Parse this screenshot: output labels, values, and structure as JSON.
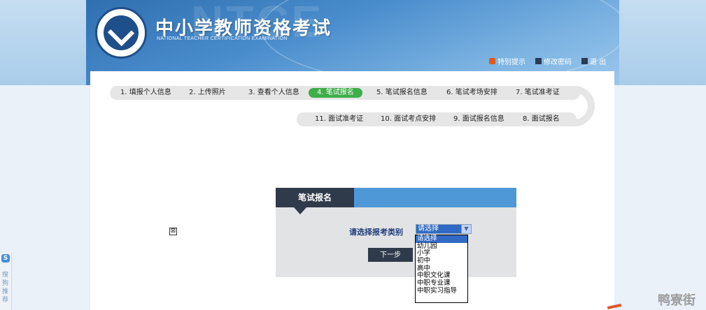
{
  "header": {
    "watermark": "NTCE",
    "title": "中小学教师资格考试",
    "subtitle": "NATIONAL TEACHER CERTIFICATION EXAMINATION",
    "links": [
      {
        "label": "特别提示",
        "icon": "notice-icon",
        "color": "#e05a1a"
      },
      {
        "label": "修改密码",
        "icon": "password-icon",
        "color": "#2b3b55"
      },
      {
        "label": "退 出",
        "icon": "exit-icon",
        "color": "#2b3b55"
      }
    ]
  },
  "steps": {
    "row1": [
      {
        "label": "1. 填报个人信息"
      },
      {
        "label": "2. 上传照片"
      },
      {
        "label": "3. 查看个人信息"
      },
      {
        "label": "4. 笔试报名",
        "active": true
      },
      {
        "label": "5. 笔试报名信息"
      },
      {
        "label": "6. 笔试考场安排"
      },
      {
        "label": "7. 笔试准考证"
      }
    ],
    "row2": [
      {
        "label": "11. 面试准考证"
      },
      {
        "label": "10. 面试考点安排"
      },
      {
        "label": "9. 面试报名信息"
      },
      {
        "label": "8. 面试报名"
      }
    ]
  },
  "form": {
    "tab_title": "笔试报名",
    "category_label": "请选择报考类别",
    "selected": "请选择",
    "next_label": "下一步",
    "options": [
      "请选择",
      "幼儿园",
      "小学",
      "初中",
      "高中",
      "中职文化课",
      "中职专业课",
      "中职实习指导"
    ],
    "highlighted_option": "请选择"
  },
  "sidebar_widget": {
    "icon_letter": "S",
    "text": "搜狗推荐"
  },
  "corner_watermark": "鸭寮街",
  "colors": {
    "active_step": "#3fae49",
    "form_header": "#4e98d7",
    "form_tab": "#2f3a4a",
    "form_body": "#e2e3e5"
  }
}
